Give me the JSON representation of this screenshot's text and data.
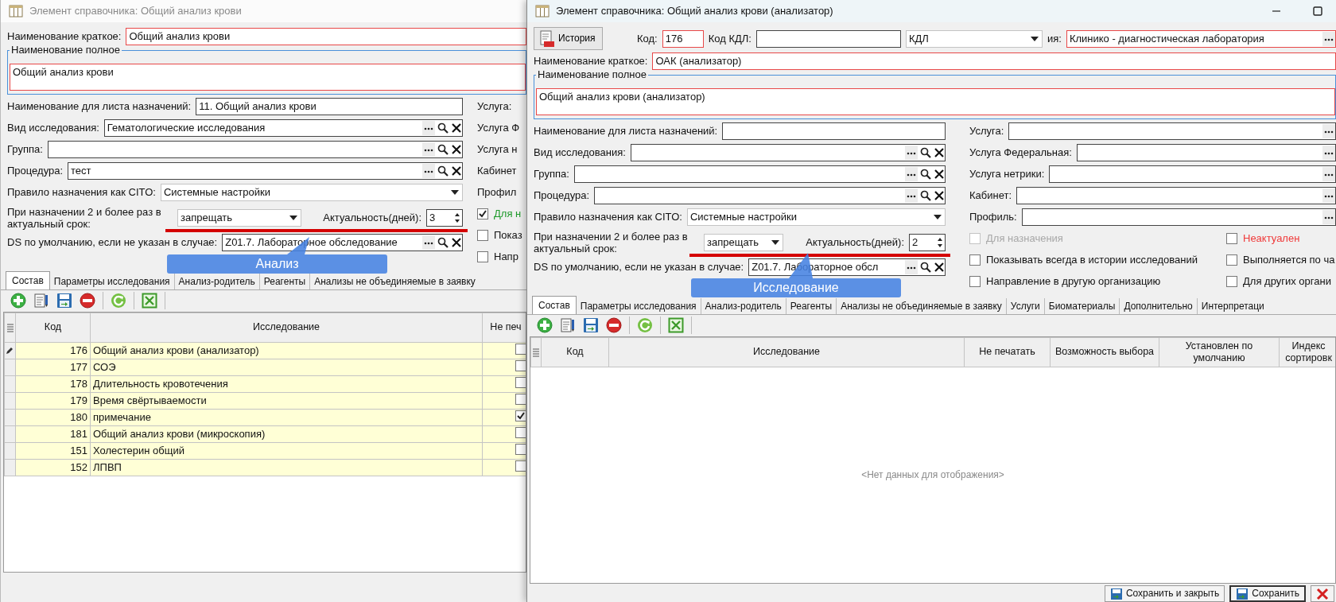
{
  "windows": [
    {
      "title": "Элемент справочника: Общий анализ крови",
      "active": false,
      "short_name": {
        "label": "Наименование краткое:",
        "value": "Общий анализ крови",
        "required": true
      },
      "full_name": {
        "legend": "Наименование полное",
        "value": "Общий анализ крови",
        "required": true
      },
      "form_left": [
        {
          "kind": "text",
          "label": "Наименование для листа назначений:",
          "value": "11. Общий анализ крови"
        },
        {
          "kind": "lookup",
          "label": "Вид исследования:",
          "value": "Гематологические исследования"
        },
        {
          "kind": "lookup",
          "label": "Группа:"
        },
        {
          "kind": "lookup",
          "label": "Процедура:",
          "value": "тест"
        },
        {
          "kind": "select",
          "label": "Правило назначения как CITO:",
          "value": "Системные настройки"
        },
        {
          "kind": "repeat",
          "label": "При назначении 2 и более раз в актуальный срок:",
          "value": "запрещать",
          "sub_label": "Актуальность(дней):",
          "sub_value": "3"
        },
        {
          "kind": "lookup",
          "label": "DS по умолчанию, если не указан в случае:",
          "value": "Z01.7. Лабораторное обследование"
        }
      ],
      "form_right": [
        {
          "kind": "label",
          "label": "Услуга:"
        },
        {
          "kind": "label",
          "label": "Услуга Ф"
        },
        {
          "kind": "label",
          "label": "Услуга н"
        },
        {
          "kind": "label",
          "label": "Кабинет"
        },
        {
          "kind": "label",
          "label": "Профил"
        },
        {
          "kind": "check",
          "label": "Для н",
          "checked": true,
          "disabled": false,
          "color": "#1e9a2a"
        },
        {
          "kind": "check",
          "label": "Показ",
          "checked": false,
          "disabled": false
        },
        {
          "kind": "check",
          "label": "Напр",
          "checked": false,
          "disabled": false
        }
      ],
      "callout": "Анализ",
      "tabs": [
        {
          "label": "Состав",
          "selected": true
        },
        {
          "label": "Параметры исследования",
          "selected": false
        },
        {
          "label": "Анализ-родитель",
          "selected": false
        },
        {
          "label": "Реагенты",
          "selected": false
        },
        {
          "label": "Анализы не объединяемые в заявку",
          "selected": false
        }
      ],
      "table": {
        "columns": [
          "Код",
          "Исследование",
          "Не печ"
        ],
        "rows": [
          {
            "code": "176",
            "name": "Общий анализ крови (анализатор)",
            "no_print": false,
            "current": true
          },
          {
            "code": "177",
            "name": "СОЭ",
            "no_print": false,
            "current": false
          },
          {
            "code": "178",
            "name": "Длительность кровотечения",
            "no_print": false,
            "current": false
          },
          {
            "code": "179",
            "name": "Время свёртываемости",
            "no_print": false,
            "current": false
          },
          {
            "code": "180",
            "name": "примечание",
            "no_print": true,
            "current": false
          },
          {
            "code": "181",
            "name": "Общий анализ крови (микроскопия)",
            "no_print": false,
            "current": false
          },
          {
            "code": "151",
            "name": "Холестерин общий",
            "no_print": false,
            "current": false
          },
          {
            "code": "152",
            "name": "ЛПВП",
            "no_print": false,
            "current": false
          }
        ]
      }
    },
    {
      "title": "Элемент справочника: Общий анализ крови (анализатор)",
      "active": true,
      "header": [
        {
          "kind": "button",
          "label": "История"
        },
        {
          "kind": "text",
          "label": "Код:",
          "value": "176",
          "required": true
        },
        {
          "kind": "text",
          "label": "Код КДЛ:",
          "required": false
        },
        {
          "kind": "select",
          "value": "КДЛ"
        },
        {
          "kind": "lookup_short",
          "label": "ия:",
          "value": "Клинико - диагностическая лаборатория",
          "required": true
        }
      ],
      "short_name": {
        "label": "Наименование краткое:",
        "value": "ОАК (анализатор)",
        "required": true
      },
      "full_name": {
        "legend": "Наименование полное",
        "value": "Общий анализ крови (анализатор)",
        "required": true
      },
      "form_left": [
        {
          "kind": "text",
          "label": "Наименование для листа назначений:"
        },
        {
          "kind": "lookup",
          "label": "Вид исследования:"
        },
        {
          "kind": "lookup",
          "label": "Группа:"
        },
        {
          "kind": "lookup",
          "label": "Процедура:"
        },
        {
          "kind": "select",
          "label": "Правило назначения как CITO:",
          "value": "Системные настройки"
        },
        {
          "kind": "repeat",
          "label": "При назначении 2 и более раз в актуальный срок:",
          "value": "запрещать",
          "sub_label": "Актуальность(дней):",
          "sub_value": "2"
        },
        {
          "kind": "lookup",
          "label": "DS по умолчанию, если не указан в случае:",
          "value": "Z01.7. Лабораторное обсл"
        }
      ],
      "form_right": [
        {
          "kind": "lookup_short",
          "label": "Услуга:"
        },
        {
          "kind": "lookup_short",
          "label": "Услуга Федеральная:"
        },
        {
          "kind": "lookup_short",
          "label": "Услуга нетрики:"
        },
        {
          "kind": "lookup_short",
          "label": "Кабинет:"
        },
        {
          "kind": "lookup_short",
          "label": "Профиль:"
        }
      ],
      "checks": [
        {
          "label": "Для назначения",
          "checked": false,
          "disabled": true
        },
        {
          "label": "Неактуален",
          "checked": false,
          "disabled": false,
          "color": "#f03a3a"
        },
        {
          "label": "Показывать всегда в истории исследований",
          "checked": false,
          "disabled": false
        },
        {
          "label": "Выполняется по ча",
          "checked": false,
          "disabled": false
        },
        {
          "label": "Направление в другую организацию",
          "checked": false,
          "disabled": false
        },
        {
          "label": "Для других органи",
          "checked": false,
          "disabled": false
        }
      ],
      "callout": "Исследование",
      "tabs": [
        {
          "label": "Состав",
          "selected": true
        },
        {
          "label": "Параметры исследования",
          "selected": false
        },
        {
          "label": "Анализ-родитель",
          "selected": false
        },
        {
          "label": "Реагенты",
          "selected": false
        },
        {
          "label": "Анализы не объединяемые в заявку",
          "selected": false
        },
        {
          "label": "Услуги",
          "selected": false
        },
        {
          "label": "Биоматериалы",
          "selected": false
        },
        {
          "label": "Дополнительно",
          "selected": false
        },
        {
          "label": "Интерпретаци",
          "selected": false
        }
      ],
      "table": {
        "columns": [
          "Код",
          "Исследование",
          "Не печатать",
          "Возможность выбора",
          "Установлен по умолчанию",
          "Индекс сортировк"
        ],
        "empty_text": "<Нет данных для отображения>"
      },
      "buttons": [
        {
          "kind": "save_close",
          "label": "Сохранить и закрыть",
          "default": false
        },
        {
          "kind": "save",
          "label": "Сохранить",
          "default": true
        },
        {
          "kind": "cancel",
          "default": false
        }
      ]
    }
  ]
}
